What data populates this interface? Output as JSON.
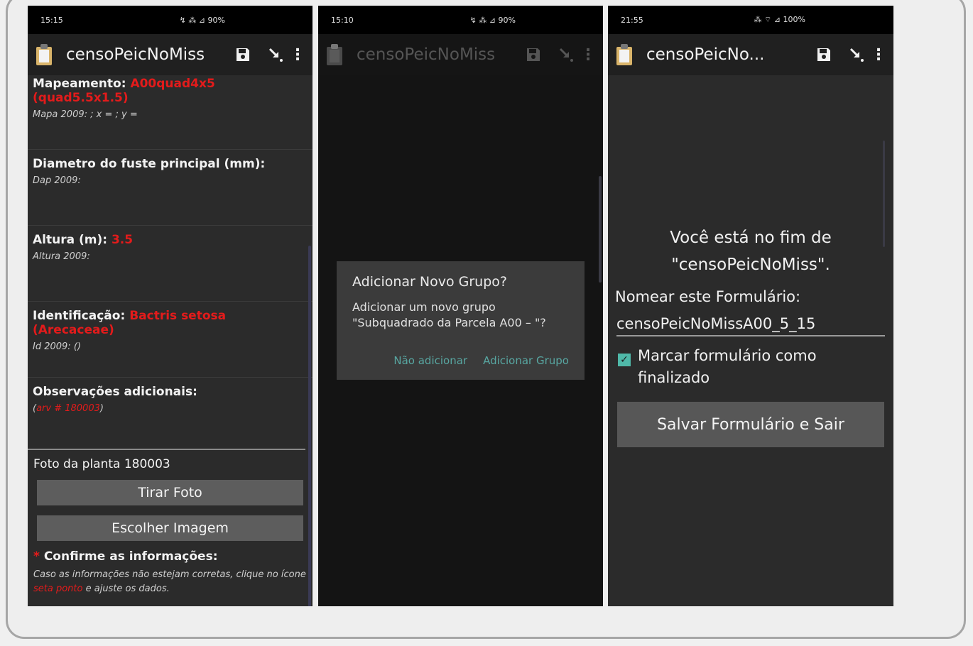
{
  "screens": [
    {
      "status": {
        "time": "15:15",
        "icons": "☐ ▣ ●",
        "right": "↯ ⁂ ⊿ 90%"
      },
      "toolbar": {
        "title": "censoPeicNoMiss"
      },
      "questions": [
        {
          "label": "Mapeamento:",
          "value": "A00quad4x5 (quad5.5x1.5)",
          "hint": "Mapa 2009: ; x = ; y ="
        },
        {
          "label": "Diametro do fuste principal (mm):",
          "value": "",
          "hint": "Dap 2009:"
        },
        {
          "label": "Altura (m):",
          "value": "3.5",
          "hint": "Altura 2009:"
        },
        {
          "label": "Identificação:",
          "value": "Bactris setosa (Arecaceae)",
          "hint": "Id 2009: ()"
        },
        {
          "label": "Observações adicionais:",
          "value": "",
          "hint_pre": "(",
          "hint_red": "arv # 180003",
          "hint_post": ")"
        }
      ],
      "photo_label": "Foto da planta 180003",
      "take_photo": "Tirar Foto",
      "choose_image": "Escolher Imagem",
      "confirm": {
        "asterisk": "*",
        "label": "Confirme as informações:",
        "hint_pre": "Caso as informações não estejam corretas, clique no ícone",
        "hint_red": "seta ponto",
        "hint_post": "e ajuste os dados."
      }
    },
    {
      "status": {
        "time": "15:10",
        "icons": "☐ ▣ ●",
        "right": "↯ ⁂ ⊿ 90%"
      },
      "toolbar": {
        "title": "censoPeicNoMiss"
      },
      "dialog": {
        "title": "Adicionar Novo Grupo?",
        "message_line1": "Adicionar um novo grupo",
        "message_line2": "\"Subquadrado da Parcela A00 – \"?",
        "cancel": "Não adicionar",
        "confirm": "Adicionar Grupo"
      }
    },
    {
      "status": {
        "time": "21:55",
        "icons": "⊙ ☐ ≡ ···",
        "right": "⁂ ⌔ ⊿ 100%"
      },
      "toolbar": {
        "title": "censoPeicNo..."
      },
      "end_line1": "Você está no fim de",
      "end_line2": "\"censoPeicNoMiss\".",
      "name_label": "Nomear este Formulário:",
      "name_value": "censoPeicNoMissA00_5_15",
      "mark_finalized": "Marcar formulário como finalizado",
      "save_exit": "Salvar Formulário e Sair"
    }
  ],
  "colors": {
    "accent": "#58a7a2",
    "required": "#e31b1b",
    "checkbox": "#4fb9a9"
  }
}
